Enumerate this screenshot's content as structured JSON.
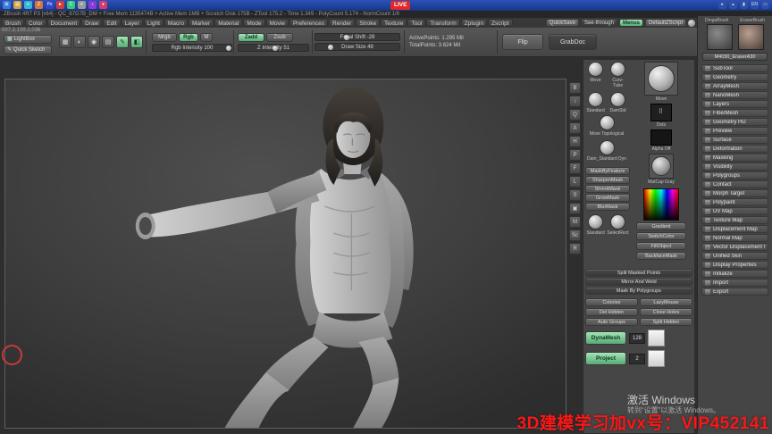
{
  "taskbar": {
    "live_label": "LIVE",
    "left_icons": [
      {
        "name": "start-icon",
        "g": "⊞"
      },
      {
        "name": "explorer-icon",
        "g": "▤"
      },
      {
        "name": "browser-icon",
        "g": "e"
      },
      {
        "name": "zbrush-icon",
        "g": "Z"
      },
      {
        "name": "photoshop-icon",
        "g": "Ps"
      },
      {
        "name": "media-player-icon",
        "g": "►"
      },
      {
        "name": "chat-icon",
        "g": "C"
      },
      {
        "name": "notes-icon",
        "g": "≡"
      },
      {
        "name": "music-icon",
        "g": "♪"
      },
      {
        "name": "recorder-icon",
        "g": "●"
      }
    ],
    "tray_icons": [
      {
        "name": "volume-icon",
        "g": "▸"
      },
      {
        "name": "network-icon",
        "g": "▴"
      },
      {
        "name": "battery-icon",
        "g": "▮"
      },
      {
        "name": "language-icon",
        "g": "EN"
      },
      {
        "name": "notification-icon",
        "g": "▭"
      }
    ]
  },
  "titlebar": {
    "text": "ZBrush 4R7 P3 [x64] - QC_67G7B_DM + Free Mem 1135474B + Active Mem 1MB + Scratch Disk 175B - ZTool 175.2 - Time 1.349 - PolyCount 5.174 - NormCount 1/6"
  },
  "menubar": {
    "items": [
      "Brush",
      "Color",
      "Document",
      "Draw",
      "Edit",
      "Layer",
      "Light",
      "Macro",
      "Marker",
      "Material",
      "Mode",
      "Movie",
      "Preferences",
      "Render",
      "Stroke",
      "Texture",
      "Tool",
      "Transform",
      "Zplugin",
      "Zscript"
    ],
    "quicksave": "QuickSave",
    "see_through": "See-through",
    "menus": "Menus",
    "default_zscript": "DefaultZScript"
  },
  "toolbar": {
    "doc_info": "007,2,139,2,036",
    "lightbox": "LightBox",
    "quick_sketch": "Quick Sketch",
    "icon_cluster": [
      {
        "name": "projection-master-icon",
        "g": "▦"
      },
      {
        "name": "light-icon",
        "g": "◐"
      },
      {
        "name": "eye-icon",
        "g": "◉"
      },
      {
        "name": "layers-icon",
        "g": "▤"
      },
      {
        "name": "draw-pen-icon",
        "g": "✎"
      },
      {
        "name": "paint-icon",
        "g": "◧"
      }
    ],
    "mrgb": "Mrgb",
    "rgb": "Rgb",
    "m": "M",
    "rgb_intensity": "Rgb Intensity 100",
    "zadd": "Zadd",
    "zsub": "Zsub",
    "z_intensity": "Z Intensity 51",
    "focal_shift": "Focal Shift -28",
    "draw_size": "Draw Size 48",
    "active_points": "ActivePoints: 1.295 Mil",
    "total_points": "TotalPoints: 3.624 Mil",
    "flip": "Flip",
    "grabdoc": "GrabDoc"
  },
  "shelf_icons": [
    {
      "name": "bpr-icon",
      "g": "B"
    },
    {
      "name": "scroll-icon",
      "g": "↕"
    },
    {
      "name": "zoom-icon",
      "g": "Q"
    },
    {
      "name": "actual-size-icon",
      "g": "A"
    },
    {
      "name": "aa-half-icon",
      "g": "H"
    },
    {
      "name": "persp-icon",
      "g": "P"
    },
    {
      "name": "floor-icon",
      "g": "F"
    },
    {
      "name": "local-icon",
      "g": "L"
    },
    {
      "name": "lsym-icon",
      "g": "S"
    },
    {
      "name": "frame-icon",
      "g": "▣"
    },
    {
      "name": "move-icon",
      "g": "M"
    },
    {
      "name": "scale-icon",
      "g": "Sc"
    },
    {
      "name": "rotate-icon",
      "g": "R"
    }
  ],
  "tray_panel": {
    "small_thumbs": [
      {
        "label": "Move"
      },
      {
        "label": "Curv-Tube"
      },
      {
        "label": "Standard"
      },
      {
        "label": "DamStd"
      }
    ],
    "row_thumbs": [
      {
        "label": "Move Topological"
      },
      {
        "label": "Dam_Standard Dyn"
      }
    ],
    "picker_thumbs": [
      {
        "label": "Standard"
      },
      {
        "label": "SelectRect"
      }
    ],
    "current_brush": "Move",
    "stroke": "Dots",
    "alpha": "Alpha Off",
    "material": "MatCap Gray",
    "gradient": "Gradient",
    "switch_color": "SwitchColor",
    "fill_object": "FillObject",
    "backface_mask": "BackfaceMask",
    "mask_buttons": [
      "MaskByFeature",
      "SharpenMask",
      "ShrinkMask",
      "GrowMask",
      "BlurMask"
    ],
    "wide_buttons": [
      "Split Masked Points",
      "Mirror And Weld",
      "Mask By Polygroups"
    ],
    "small_buttons": [
      "Colorize",
      "LazyMouse",
      "Del Hidden",
      "Close Holes",
      "Auto Groups",
      "Split Hidden"
    ],
    "dynamesh": "DynaMesh",
    "dynamesh_res": "128",
    "project": "Project",
    "project_blur": "2"
  },
  "tool_panel": {
    "thumb_label_left": "DmgaBrush",
    "thumb_label_right": "EraserBrush",
    "current_tool": "M4030_EraserA30",
    "menu": [
      "SubTool",
      "Geometry",
      "ArrayMesh",
      "NanoMesh",
      "Layers",
      "FiberMesh",
      "Geometry HD",
      "Preview",
      "Surface",
      "Deformation",
      "Masking",
      "Visibility",
      "Polygroups",
      "Contact",
      "Morph Target",
      "Polypaint",
      "UV Map",
      "Texture Map",
      "Displacement Map",
      "Normal Map",
      "Vector Displacement Map",
      "Unified Skin",
      "Display Properties",
      "Initialize",
      "Import",
      "Export"
    ]
  },
  "overlays": {
    "watermark": "3D建模学习加vx号：VIP452141",
    "win_activate": "激活 Windows",
    "win_activate_sub": "转到“设置”以激活 Windows。"
  }
}
